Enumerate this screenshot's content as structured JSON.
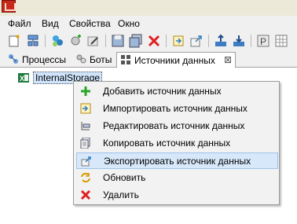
{
  "menubar": {
    "items": [
      "Файл",
      "Вид",
      "Свойства",
      "Окно"
    ]
  },
  "tabs": [
    {
      "label": "Процессы",
      "icon": "process-icon",
      "active": false
    },
    {
      "label": "Боты",
      "icon": "bots-icon",
      "active": false
    },
    {
      "label": "Источники данных",
      "icon": "datasource-icon",
      "active": true
    }
  ],
  "tree": {
    "selected_item": "InternalStorage",
    "icon": "excel-icon"
  },
  "context_menu": {
    "items": [
      {
        "label": "Добавить источник данных",
        "icon": "plus-icon"
      },
      {
        "label": "Импортировать источник данных",
        "icon": "import-icon"
      },
      {
        "label": "Редактировать источник данных",
        "icon": "edit-icon"
      },
      {
        "label": "Копировать источник данных",
        "icon": "copy-icon"
      },
      {
        "label": "Экспортировать источник данных",
        "icon": "export-icon",
        "highlighted": true
      },
      {
        "label": "Обновить",
        "icon": "refresh-icon"
      },
      {
        "label": "Удалить",
        "icon": "delete-icon"
      }
    ]
  },
  "colors": {
    "selection": "#cfe4fb",
    "menu_hover": "#d7e8fa",
    "delete_red": "#e02020",
    "add_green": "#2aa52a"
  }
}
